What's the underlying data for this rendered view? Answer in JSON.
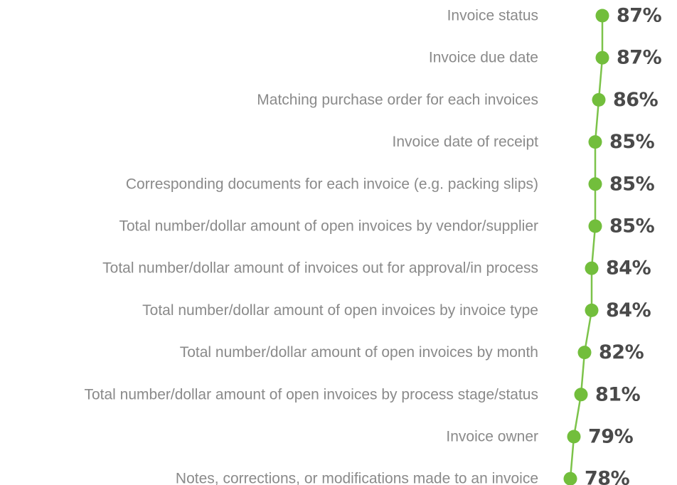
{
  "colors": {
    "line": "#7cc34a",
    "marker": "#72be3c",
    "category_text": "#8a8a8a",
    "value_text": "#4a4a4a"
  },
  "chart_data": {
    "type": "line",
    "orientation": "horizontal",
    "title": "",
    "xlabel": "",
    "ylabel": "",
    "value_suffix": "%",
    "grid": false,
    "categories": [
      "Invoice status",
      "Invoice due date",
      "Matching purchase order for each invoices",
      "Invoice date of receipt",
      "Corresponding documents for each invoice (e.g. packing slips)",
      "Total number/dollar amount of open invoices by vendor/supplier",
      "Total number/dollar amount of invoices out for approval/in process",
      "Total number/dollar amount of open invoices by invoice type",
      "Total number/dollar amount of open invoices by month",
      "Total number/dollar amount of open invoices by process stage/status",
      "Invoice owner",
      "Notes, corrections, or modifications made to an invoice"
    ],
    "values": [
      87,
      87,
      86,
      85,
      85,
      85,
      84,
      84,
      82,
      81,
      79,
      78
    ],
    "value_labels": [
      "87%",
      "87%",
      "86%",
      "85%",
      "85%",
      "85%",
      "84%",
      "84%",
      "82%",
      "81%",
      "79%",
      "78%"
    ]
  }
}
